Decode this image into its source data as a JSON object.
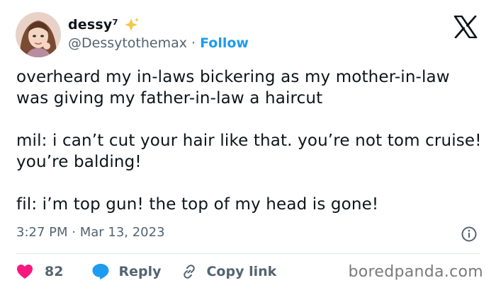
{
  "author": {
    "display_name": "dessy⁷",
    "handle": "@Dessytothemax",
    "separator": "·",
    "follow_label": "Follow",
    "sparkle_icon": "sparkles-icon",
    "avatar_icon": "avatar"
  },
  "tweet": {
    "paragraphs": [
      "overheard my in-laws bickering as my mother-in-law was giving my father-in-law a haircut",
      "mil: i can’t cut your hair like that. you’re not tom cruise! you’re balding!",
      "fil: i’m top gun! the top of my head is gone!"
    ],
    "timestamp": "3:27 PM · Mar 13, 2023"
  },
  "actions": {
    "like_count": "82",
    "reply_label": "Reply",
    "copy_link_label": "Copy link"
  },
  "watermark": "boredpanda.com",
  "colors": {
    "accent": "#1d9bf0",
    "like": "#f91880",
    "muted": "#536471",
    "sparkle": "#f7c743"
  }
}
